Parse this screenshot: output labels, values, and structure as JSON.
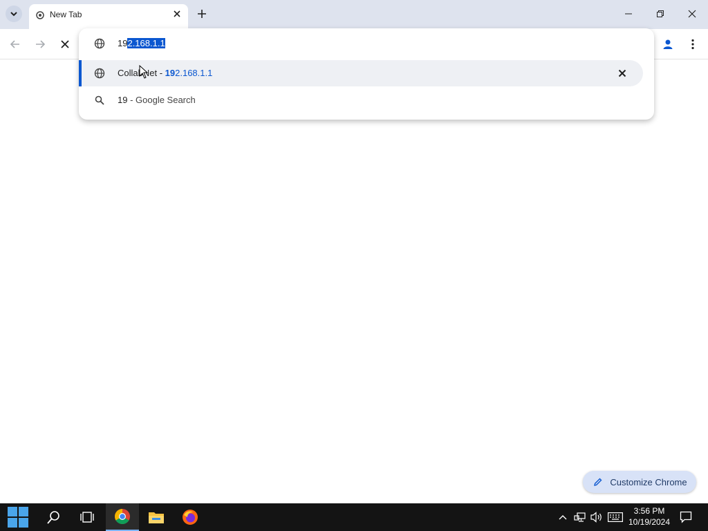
{
  "tab": {
    "title": "New Tab"
  },
  "omnibox": {
    "typed": "19",
    "autocomplete": "2.168.1.1",
    "suggestions": [
      {
        "title": "CollabNet",
        "separator": " - ",
        "url_match": "19",
        "url_rest": "2.168.1.1",
        "icon": "globe-icon"
      },
      {
        "query": "19",
        "suffix": " - Google Search",
        "icon": "search-icon"
      }
    ]
  },
  "customize_label": "Customize Chrome",
  "clock": {
    "time": "3:56 PM",
    "date": "10/19/2024"
  },
  "colors": {
    "accent": "#0b57d0",
    "titlebar": "#dee3ee",
    "taskbar": "#141414"
  }
}
